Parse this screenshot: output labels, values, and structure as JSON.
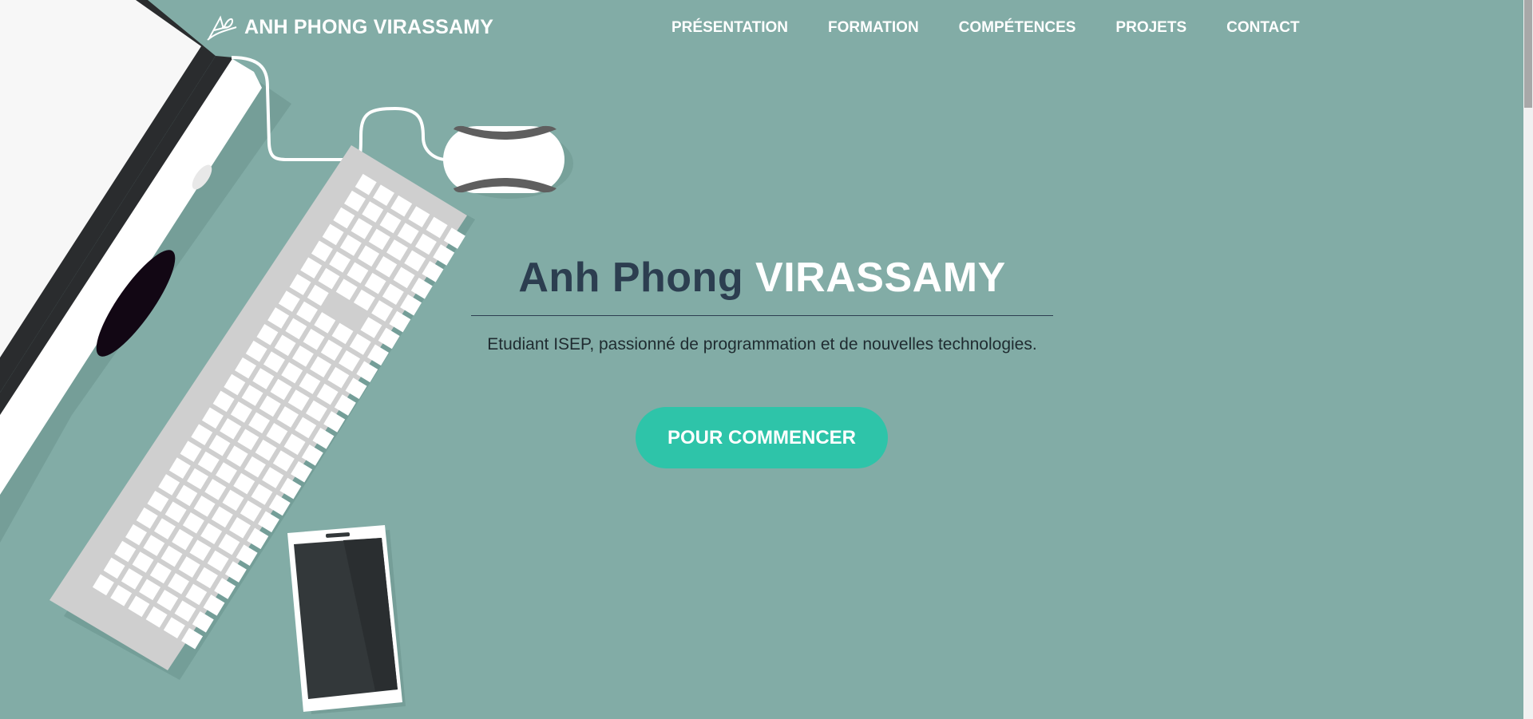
{
  "brand": {
    "logo_icon": "signature-logo-icon",
    "name": "ANH PHONG VIRASSAMY"
  },
  "nav": {
    "items": [
      {
        "label": "PRÉSENTATION"
      },
      {
        "label": "FORMATION"
      },
      {
        "label": "COMPÉTENCES"
      },
      {
        "label": "PROJETS"
      },
      {
        "label": "CONTACT"
      }
    ]
  },
  "hero": {
    "first_name": "Anh Phong",
    "last_name": "VIRASSAMY",
    "subtitle": "Etudiant ISEP, passionné de programmation et de nouvelles technologies.",
    "cta_label": "POUR COMMENCER"
  },
  "colors": {
    "background": "#82aca6",
    "accent": "#2ec4a9",
    "title_dark": "#2c3e50",
    "title_light": "#ffffff"
  },
  "illustration": {
    "items": [
      "monitor-icon",
      "keyboard-icon",
      "mouse-icon",
      "smartphone-icon"
    ]
  }
}
